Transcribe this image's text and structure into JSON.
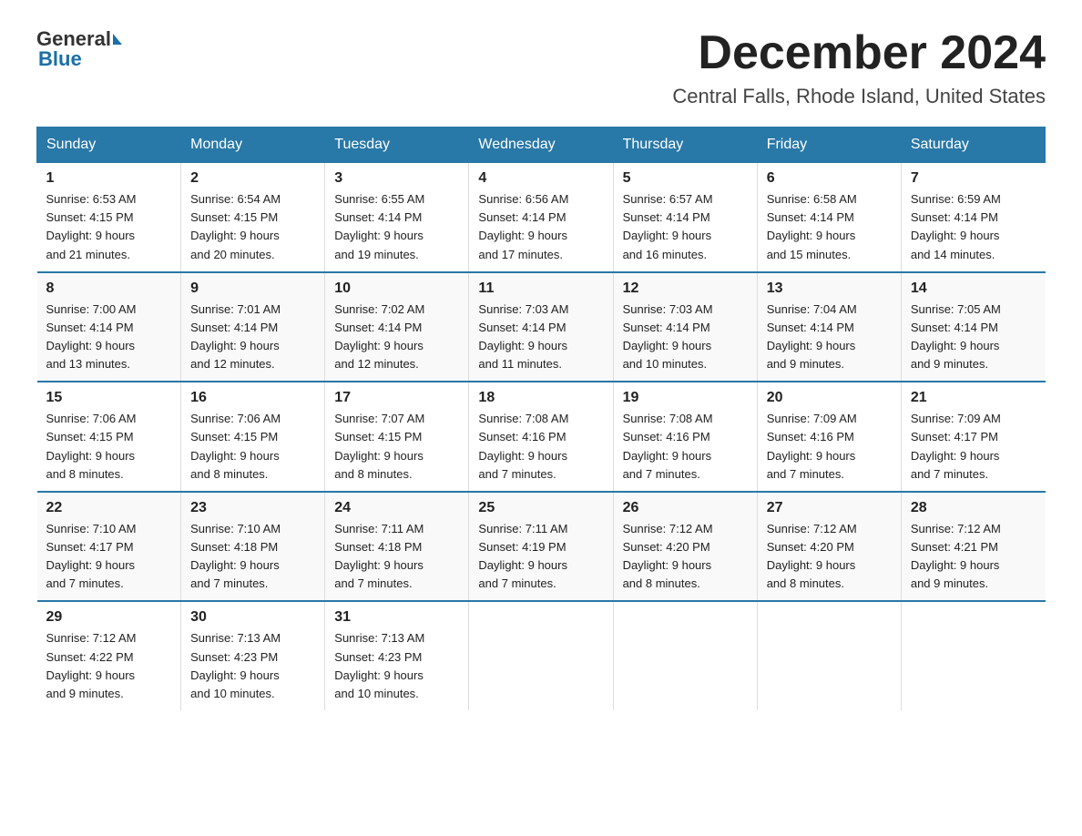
{
  "header": {
    "logo_general": "General",
    "logo_blue": "Blue",
    "month_title": "December 2024",
    "location": "Central Falls, Rhode Island, United States"
  },
  "days_of_week": [
    "Sunday",
    "Monday",
    "Tuesday",
    "Wednesday",
    "Thursday",
    "Friday",
    "Saturday"
  ],
  "weeks": [
    [
      {
        "num": "1",
        "sunrise": "6:53 AM",
        "sunset": "4:15 PM",
        "daylight": "9 hours and 21 minutes."
      },
      {
        "num": "2",
        "sunrise": "6:54 AM",
        "sunset": "4:15 PM",
        "daylight": "9 hours and 20 minutes."
      },
      {
        "num": "3",
        "sunrise": "6:55 AM",
        "sunset": "4:14 PM",
        "daylight": "9 hours and 19 minutes."
      },
      {
        "num": "4",
        "sunrise": "6:56 AM",
        "sunset": "4:14 PM",
        "daylight": "9 hours and 17 minutes."
      },
      {
        "num": "5",
        "sunrise": "6:57 AM",
        "sunset": "4:14 PM",
        "daylight": "9 hours and 16 minutes."
      },
      {
        "num": "6",
        "sunrise": "6:58 AM",
        "sunset": "4:14 PM",
        "daylight": "9 hours and 15 minutes."
      },
      {
        "num": "7",
        "sunrise": "6:59 AM",
        "sunset": "4:14 PM",
        "daylight": "9 hours and 14 minutes."
      }
    ],
    [
      {
        "num": "8",
        "sunrise": "7:00 AM",
        "sunset": "4:14 PM",
        "daylight": "9 hours and 13 minutes."
      },
      {
        "num": "9",
        "sunrise": "7:01 AM",
        "sunset": "4:14 PM",
        "daylight": "9 hours and 12 minutes."
      },
      {
        "num": "10",
        "sunrise": "7:02 AM",
        "sunset": "4:14 PM",
        "daylight": "9 hours and 12 minutes."
      },
      {
        "num": "11",
        "sunrise": "7:03 AM",
        "sunset": "4:14 PM",
        "daylight": "9 hours and 11 minutes."
      },
      {
        "num": "12",
        "sunrise": "7:03 AM",
        "sunset": "4:14 PM",
        "daylight": "9 hours and 10 minutes."
      },
      {
        "num": "13",
        "sunrise": "7:04 AM",
        "sunset": "4:14 PM",
        "daylight": "9 hours and 9 minutes."
      },
      {
        "num": "14",
        "sunrise": "7:05 AM",
        "sunset": "4:14 PM",
        "daylight": "9 hours and 9 minutes."
      }
    ],
    [
      {
        "num": "15",
        "sunrise": "7:06 AM",
        "sunset": "4:15 PM",
        "daylight": "9 hours and 8 minutes."
      },
      {
        "num": "16",
        "sunrise": "7:06 AM",
        "sunset": "4:15 PM",
        "daylight": "9 hours and 8 minutes."
      },
      {
        "num": "17",
        "sunrise": "7:07 AM",
        "sunset": "4:15 PM",
        "daylight": "9 hours and 8 minutes."
      },
      {
        "num": "18",
        "sunrise": "7:08 AM",
        "sunset": "4:16 PM",
        "daylight": "9 hours and 7 minutes."
      },
      {
        "num": "19",
        "sunrise": "7:08 AM",
        "sunset": "4:16 PM",
        "daylight": "9 hours and 7 minutes."
      },
      {
        "num": "20",
        "sunrise": "7:09 AM",
        "sunset": "4:16 PM",
        "daylight": "9 hours and 7 minutes."
      },
      {
        "num": "21",
        "sunrise": "7:09 AM",
        "sunset": "4:17 PM",
        "daylight": "9 hours and 7 minutes."
      }
    ],
    [
      {
        "num": "22",
        "sunrise": "7:10 AM",
        "sunset": "4:17 PM",
        "daylight": "9 hours and 7 minutes."
      },
      {
        "num": "23",
        "sunrise": "7:10 AM",
        "sunset": "4:18 PM",
        "daylight": "9 hours and 7 minutes."
      },
      {
        "num": "24",
        "sunrise": "7:11 AM",
        "sunset": "4:18 PM",
        "daylight": "9 hours and 7 minutes."
      },
      {
        "num": "25",
        "sunrise": "7:11 AM",
        "sunset": "4:19 PM",
        "daylight": "9 hours and 7 minutes."
      },
      {
        "num": "26",
        "sunrise": "7:12 AM",
        "sunset": "4:20 PM",
        "daylight": "9 hours and 8 minutes."
      },
      {
        "num": "27",
        "sunrise": "7:12 AM",
        "sunset": "4:20 PM",
        "daylight": "9 hours and 8 minutes."
      },
      {
        "num": "28",
        "sunrise": "7:12 AM",
        "sunset": "4:21 PM",
        "daylight": "9 hours and 9 minutes."
      }
    ],
    [
      {
        "num": "29",
        "sunrise": "7:12 AM",
        "sunset": "4:22 PM",
        "daylight": "9 hours and 9 minutes."
      },
      {
        "num": "30",
        "sunrise": "7:13 AM",
        "sunset": "4:23 PM",
        "daylight": "9 hours and 10 minutes."
      },
      {
        "num": "31",
        "sunrise": "7:13 AM",
        "sunset": "4:23 PM",
        "daylight": "9 hours and 10 minutes."
      },
      null,
      null,
      null,
      null
    ]
  ],
  "labels": {
    "sunrise": "Sunrise:",
    "sunset": "Sunset:",
    "daylight": "Daylight:"
  }
}
